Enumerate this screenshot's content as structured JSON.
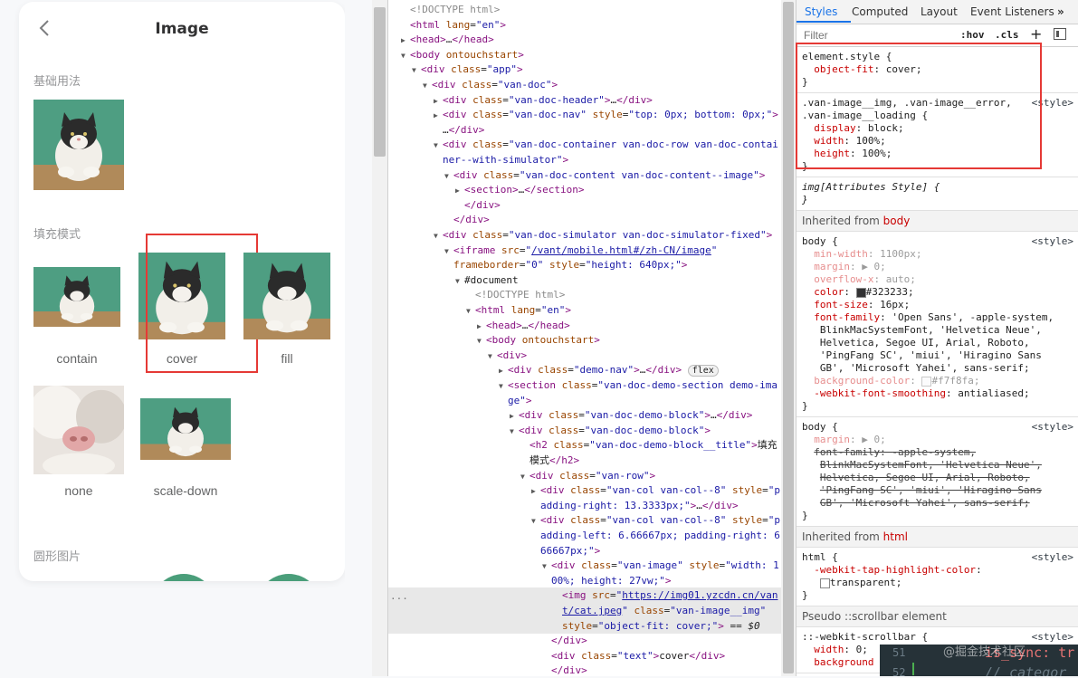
{
  "phone": {
    "title": "Image",
    "sections": {
      "basic": "基础用法",
      "fit": "填充模式",
      "round": "圆形图片"
    },
    "fit_labels": [
      "contain",
      "cover",
      "fill",
      "none",
      "scale-down"
    ]
  },
  "elements": {
    "lines": [
      {
        "i": 0,
        "arrow": "",
        "html": "<span class='c'>&lt;!DOCTYPE html&gt;</span>"
      },
      {
        "i": 0,
        "arrow": "",
        "html": "<span class='t'>&lt;html</span> <span class='a'>lang</span>=<span class='v'>\"en\"</span><span class='t'>&gt;</span>"
      },
      {
        "i": 0,
        "arrow": "▶",
        "html": "<span class='t'>&lt;head&gt;</span>…<span class='t'>&lt;/head&gt;</span>"
      },
      {
        "i": 0,
        "arrow": "▼",
        "html": "<span class='t'>&lt;body</span> <span class='a'>ontouchstart</span><span class='t'>&gt;</span>"
      },
      {
        "i": 1,
        "arrow": "▼",
        "html": "<span class='t'>&lt;div</span> <span class='a'>class</span>=<span class='v'>\"app\"</span><span class='t'>&gt;</span>"
      },
      {
        "i": 2,
        "arrow": "▼",
        "html": "<span class='t'>&lt;div</span> <span class='a'>class</span>=<span class='v'>\"van-doc\"</span><span class='t'>&gt;</span>"
      },
      {
        "i": 3,
        "arrow": "▶",
        "html": "<span class='t'>&lt;div</span> <span class='a'>class</span>=<span class='v'>\"van-doc-header\"</span><span class='t'>&gt;</span>…<span class='t'>&lt;/div&gt;</span>"
      },
      {
        "i": 3,
        "arrow": "▶",
        "html": "<span class='t'>&lt;div</span> <span class='a'>class</span>=<span class='v'>\"van-doc-nav\"</span> <span class='a'>style</span>=<span class='v'>\"top: 0px; bottom: 0px;\"</span><span class='t'>&gt;</span>"
      },
      {
        "i": 3,
        "arrow": "",
        "html": "…<span class='t'>&lt;/div&gt;</span>"
      },
      {
        "i": 3,
        "arrow": "▼",
        "html": "<span class='t'>&lt;div</span> <span class='a'>class</span>=<span class='v'>\"van-doc-container van-doc-row van-doc-contai</span>"
      },
      {
        "i": 3,
        "arrow": "",
        "html": "<span class='v'>ner--with-simulator\"</span><span class='t'>&gt;</span>"
      },
      {
        "i": 4,
        "arrow": "▼",
        "html": "<span class='t'>&lt;div</span> <span class='a'>class</span>=<span class='v'>\"van-doc-content van-doc-content--image\"</span><span class='t'>&gt;</span>"
      },
      {
        "i": 5,
        "arrow": "▶",
        "html": "<span class='t'>&lt;section&gt;</span>…<span class='t'>&lt;/section&gt;</span>"
      },
      {
        "i": 5,
        "arrow": "",
        "html": "<span class='t'>&lt;/div&gt;</span>"
      },
      {
        "i": 4,
        "arrow": "",
        "html": "<span class='t'>&lt;/div&gt;</span>"
      },
      {
        "i": 3,
        "arrow": "▼",
        "html": "<span class='t'>&lt;div</span> <span class='a'>class</span>=<span class='v'>\"van-doc-simulator van-doc-simulator-fixed\"</span><span class='t'>&gt;</span>"
      },
      {
        "i": 4,
        "arrow": "▼",
        "html": "<span class='t'>&lt;iframe</span> <span class='a'>src</span>=<span class='v'>\"</span><span class='lnk'>/vant/mobile.html#/zh-CN/image</span><span class='v'>\"</span>"
      },
      {
        "i": 4,
        "arrow": "",
        "html": "<span class='a'>frameborder</span>=<span class='v'>\"0\"</span> <span class='a'>style</span>=<span class='v'>\"height: 640px;\"</span><span class='t'>&gt;</span>"
      },
      {
        "i": 5,
        "arrow": "▼",
        "html": "#document"
      },
      {
        "i": 6,
        "arrow": "",
        "html": "<span class='c'>&lt;!DOCTYPE html&gt;</span>"
      },
      {
        "i": 6,
        "arrow": "▼",
        "html": "<span class='t'>&lt;html</span> <span class='a'>lang</span>=<span class='v'>\"en\"</span><span class='t'>&gt;</span>"
      },
      {
        "i": 7,
        "arrow": "▶",
        "html": "<span class='t'>&lt;head&gt;</span>…<span class='t'>&lt;/head&gt;</span>"
      },
      {
        "i": 7,
        "arrow": "▼",
        "html": "<span class='t'>&lt;body</span> <span class='a'>ontouchstart</span><span class='t'>&gt;</span>"
      },
      {
        "i": 8,
        "arrow": "▼",
        "html": "<span class='t'>&lt;div&gt;</span>"
      },
      {
        "i": 9,
        "arrow": "▶",
        "html": "<span class='t'>&lt;div</span> <span class='a'>class</span>=<span class='v'>\"demo-nav\"</span><span class='t'>&gt;</span>…<span class='t'>&lt;/div&gt;</span> <span style='border:1px solid #bbb;border-radius:8px;padding:0 4px;font-size:10px;background:#f1f1f1;'>flex</span>"
      },
      {
        "i": 9,
        "arrow": "▼",
        "html": "<span class='t'>&lt;section</span> <span class='a'>class</span>=<span class='v'>\"van-doc-demo-section demo-ima</span>"
      },
      {
        "i": 9,
        "arrow": "",
        "html": "<span class='v'>ge\"</span><span class='t'>&gt;</span>"
      },
      {
        "i": 10,
        "arrow": "▶",
        "html": "<span class='t'>&lt;div</span> <span class='a'>class</span>=<span class='v'>\"van-doc-demo-block\"</span><span class='t'>&gt;</span>…<span class='t'>&lt;/div&gt;</span>"
      },
      {
        "i": 10,
        "arrow": "▼",
        "html": "<span class='t'>&lt;div</span> <span class='a'>class</span>=<span class='v'>\"van-doc-demo-block\"</span><span class='t'>&gt;</span>"
      },
      {
        "i": 11,
        "arrow": "",
        "html": "<span class='t'>&lt;h2</span> <span class='a'>class</span>=<span class='v'>\"van-doc-demo-block__title\"</span><span class='t'>&gt;</span>填充"
      },
      {
        "i": 11,
        "arrow": "",
        "html": "模式<span class='t'>&lt;/h2&gt;</span>"
      },
      {
        "i": 11,
        "arrow": "▼",
        "html": "<span class='t'>&lt;div</span> <span class='a'>class</span>=<span class='v'>\"van-row\"</span><span class='t'>&gt;</span>"
      },
      {
        "i": 12,
        "arrow": "▶",
        "html": "<span class='t'>&lt;div</span> <span class='a'>class</span>=<span class='v'>\"van-col van-col--8\"</span> <span class='a'>style</span>=<span class='v'>\"p</span>"
      },
      {
        "i": 12,
        "arrow": "",
        "html": "<span class='v'>adding-right: 13.3333px;\"</span><span class='t'>&gt;</span>…<span class='t'>&lt;/div&gt;</span>"
      },
      {
        "i": 12,
        "arrow": "▼",
        "html": "<span class='t'>&lt;div</span> <span class='a'>class</span>=<span class='v'>\"van-col van-col--8\"</span> <span class='a'>style</span>=<span class='v'>\"p</span>"
      },
      {
        "i": 12,
        "arrow": "",
        "html": "<span class='v'>adding-left: 6.66667px; padding-right: 6.</span>"
      },
      {
        "i": 12,
        "arrow": "",
        "html": "<span class='v'>66667px;\"</span><span class='t'>&gt;</span>"
      },
      {
        "i": 13,
        "arrow": "▼",
        "html": "<span class='t'>&lt;div</span> <span class='a'>class</span>=<span class='v'>\"van-image\"</span> <span class='a'>style</span>=<span class='v'>\"width: 1</span>"
      },
      {
        "i": 13,
        "arrow": "",
        "html": "<span class='v'>00%; height: 27vw;\"</span><span class='t'>&gt;</span>"
      },
      {
        "i": 14,
        "arrow": "",
        "sel": true,
        "html": "<span class='t'>&lt;img</span> <span class='a'>src</span>=<span class='v'>\"</span><span class='lnk'>https://img01.yzcdn.cn/van</span>"
      },
      {
        "i": 14,
        "arrow": "",
        "sel": true,
        "html": "<span class='lnk'>t/cat.jpeg</span><span class='v'>\"</span> <span class='a'>class</span>=<span class='v'>\"van-image__img\"</span>"
      },
      {
        "i": 14,
        "arrow": "",
        "sel": true,
        "html": "<span class='a'>style</span>=<span class='v'>\"object-fit: cover;\"</span><span class='t'>&gt;</span> == <i>$0</i>"
      },
      {
        "i": 13,
        "arrow": "",
        "html": "<span class='t'>&lt;/div&gt;</span>"
      },
      {
        "i": 13,
        "arrow": "",
        "html": "<span class='t'>&lt;div</span> <span class='a'>class</span>=<span class='v'>\"text\"</span><span class='t'>&gt;</span>cover<span class='t'>&lt;/div&gt;</span>"
      },
      {
        "i": 13,
        "arrow": "",
        "html": "<span class='t'>&lt;/div&gt;</span>"
      }
    ]
  },
  "styles": {
    "tabs": [
      "Styles",
      "Computed",
      "Layout",
      "Event Listeners",
      "»"
    ],
    "filter_placeholder": "Filter",
    "hov": ":hov",
    "cls": ".cls",
    "plus": "+",
    "rules": [
      {
        "lines": [
          {
            "h": "element.style {"
          },
          {
            "h": "  <span class='prop'>object-fit</span>: cover;"
          },
          {
            "h": "}"
          }
        ]
      },
      {
        "src": "&lt;style&gt;",
        "lines": [
          {
            "h": ".van-image__img, .van-image__error,"
          },
          {
            "h": ".van-image__loading {"
          },
          {
            "h": "  <span class='prop'>display</span>: block;"
          },
          {
            "h": "  <span class='prop'>width</span>: 100%;"
          },
          {
            "h": "  <span class='prop'>height</span>: 100%;"
          },
          {
            "h": "}"
          }
        ]
      },
      {
        "lines": [
          {
            "h": "<i>img[Attributes Style] {</i>"
          },
          {
            "h": "<i>}</i>"
          }
        ]
      },
      {
        "inherited": "Inherited from <span style='color:#c80000'>body</span>"
      },
      {
        "src": "&lt;style&gt;",
        "lines": [
          {
            "h": "body {"
          },
          {
            "h": "  <span class='prop dim'>min-width</span><span class='dim'>: 1100px;</span>"
          },
          {
            "h": "  <span class='prop dim'>margin</span><span class='dim'>: ▶ 0;</span>"
          },
          {
            "h": "  <span class='prop dim'>overflow-x</span><span class='dim'>: auto;</span>"
          },
          {
            "h": "  <span class='prop'>color</span>: <span style='display:inline-block;width:9px;height:9px;background:#323233;border:1px solid #888;vertical-align:middle'></span>#323233;"
          },
          {
            "h": "  <span class='prop'>font-size</span>: 16px;"
          },
          {
            "h": "  <span class='prop'>font-family</span>: 'Open Sans', -apple-system,"
          },
          {
            "h": "     BlinkMacSystemFont, 'Helvetica Neue',"
          },
          {
            "h": "     Helvetica, Segoe UI, Arial, Roboto,"
          },
          {
            "h": "     'PingFang SC', 'miui', 'Hiragino Sans"
          },
          {
            "h": "     GB', 'Microsoft Yahei', sans-serif;"
          },
          {
            "h": "  <span class='prop dim'>background-color</span><span class='dim'>: <span style='display:inline-block;width:9px;height:9px;background:#f7f8fa;border:1px solid #888;vertical-align:middle'></span>#f7f8fa;</span>"
          },
          {
            "h": "  <span class='prop'>-webkit-font-smoothing</span>: antialiased;"
          },
          {
            "h": "}"
          }
        ]
      },
      {
        "src": "&lt;style&gt;",
        "lines": [
          {
            "h": "body {"
          },
          {
            "h": "  <span class='prop dim'>margin</span><span class='dim'>: ▶ 0;</span>"
          },
          {
            "h": "  <span class='strike'>font-family: -apple-system,</span>"
          },
          {
            "h": "     <span class='strike'>BlinkMacSystemFont, 'Helvetica Neue',</span>"
          },
          {
            "h": "     <span class='strike'>Helvetica, Segoe UI, Arial, Roboto,</span>"
          },
          {
            "h": "     <span class='strike'>'PingFang SC', 'miui', 'Hiragino Sans</span>"
          },
          {
            "h": "     <span class='strike'>GB', 'Microsoft Yahei', sans-serif;</span>"
          },
          {
            "h": "}"
          }
        ]
      },
      {
        "inherited": "Inherited from <span style='color:#c80000'>html</span>"
      },
      {
        "src": "&lt;style&gt;",
        "lines": [
          {
            "h": "html {"
          },
          {
            "h": "  <span class='prop'>-webkit-tap-highlight-color</span>:"
          },
          {
            "h": "     <span style='display:inline-block;width:9px;height:9px;background:#fff;border:1px solid #888;vertical-align:middle'></span>transparent;"
          },
          {
            "h": "}"
          }
        ]
      },
      {
        "inherited": "Pseudo ::scrollbar element"
      },
      {
        "src": "&lt;style&gt;",
        "lines": [
          {
            "h": "::-webkit-scrollbar {"
          },
          {
            "h": "  <span class='prop'>width</span>: 0;"
          },
          {
            "h": "  <span class='prop'>background</span>"
          }
        ]
      }
    ]
  },
  "overlay": {
    "line1": "51",
    "line2": "52",
    "code1": "is_sync: tr",
    "code2": "// categor",
    "watermark": "@掘金技术社区"
  }
}
